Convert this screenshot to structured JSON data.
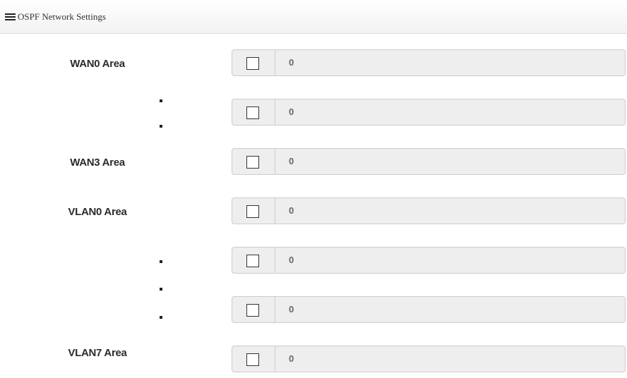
{
  "panel": {
    "icon": "list-icon",
    "title": "OSPF Network Settings"
  },
  "labels": {
    "wan0": "WAN0 Area",
    "wan3": "WAN3 Area",
    "vlan0": "VLAN0 Area",
    "vlan7": "VLAN7 Area"
  },
  "rows": [
    {
      "label": "WAN0 Area",
      "checked": false,
      "value": "0"
    },
    {
      "label": "",
      "checked": false,
      "value": "0"
    },
    {
      "label": "WAN3 Area",
      "checked": false,
      "value": "0"
    },
    {
      "label": "VLAN0 Area",
      "checked": false,
      "value": "0"
    },
    {
      "label": "",
      "checked": false,
      "value": "0"
    },
    {
      "label": "",
      "checked": false,
      "value": "0"
    },
    {
      "label": "VLAN7 Area",
      "checked": false,
      "value": "0"
    }
  ]
}
